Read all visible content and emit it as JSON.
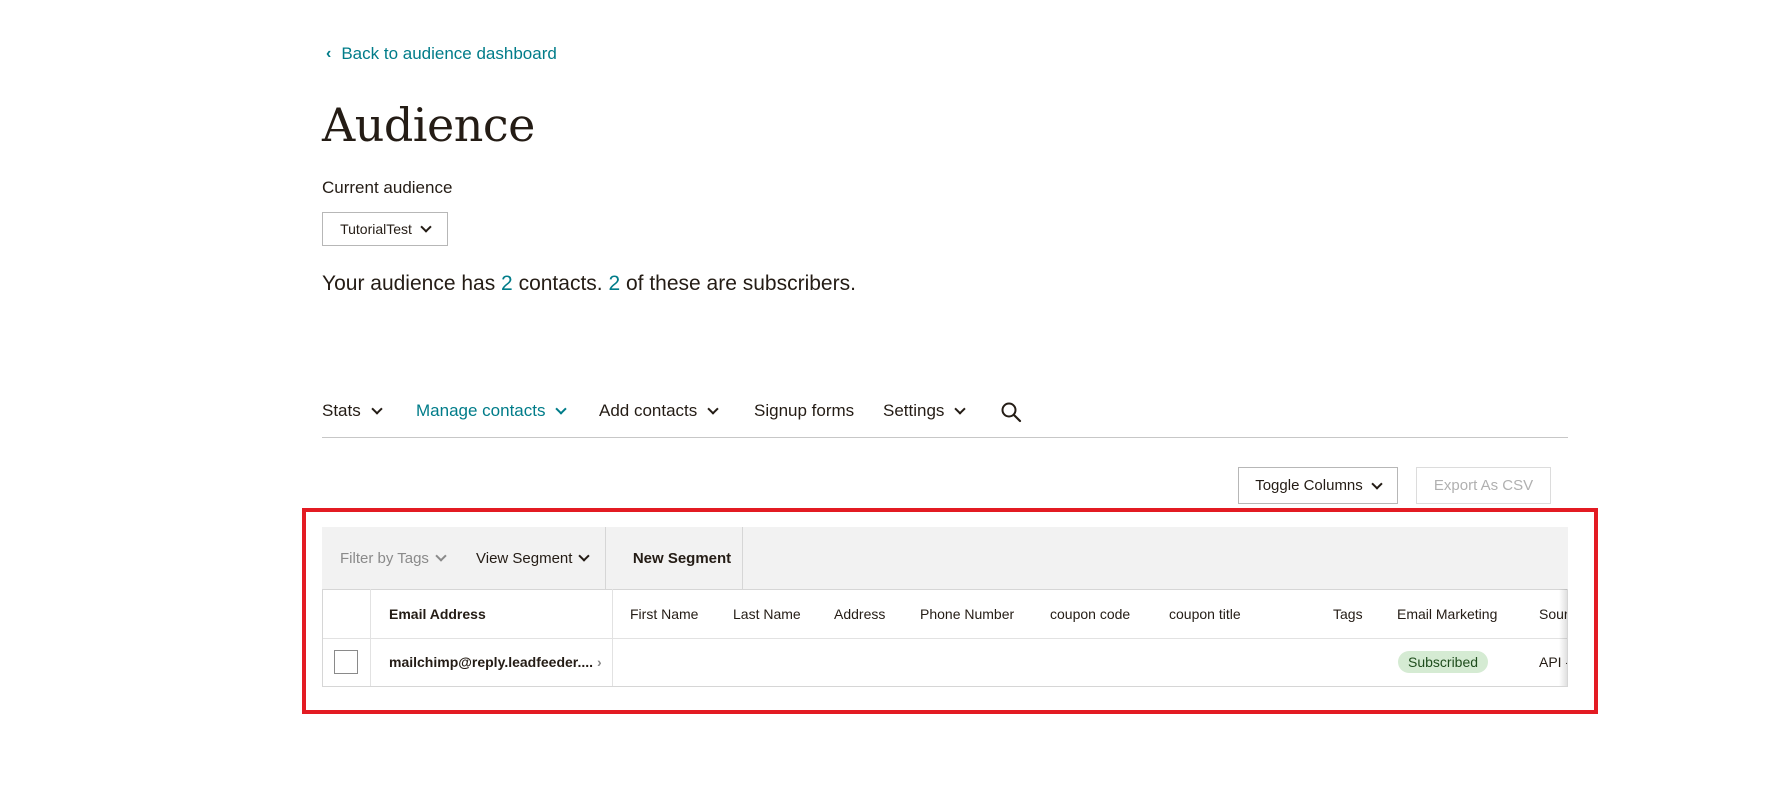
{
  "back_link": {
    "label": "Back to audience dashboard",
    "icon": "chevron-left-icon"
  },
  "page_title": "Audience",
  "current_audience": {
    "label": "Current audience",
    "selected": "TutorialTest"
  },
  "summary": {
    "prefix": "Your audience has ",
    "contacts_count": "2",
    "middle": " contacts. ",
    "subscribers_count": "2",
    "suffix": " of these are subscribers."
  },
  "nav": {
    "items": [
      {
        "label": "Stats",
        "has_dropdown": true
      },
      {
        "label": "Manage contacts",
        "has_dropdown": true,
        "active": true
      },
      {
        "label": "Add contacts",
        "has_dropdown": true
      },
      {
        "label": "Signup forms",
        "has_dropdown": false
      },
      {
        "label": "Settings",
        "has_dropdown": true
      }
    ],
    "search_icon": "search-icon"
  },
  "actions": {
    "toggle_columns": "Toggle Columns",
    "export_csv": "Export As CSV"
  },
  "toolbar": {
    "filter_by_tags": "Filter by Tags",
    "view_segment": "View Segment",
    "new_segment": "New Segment"
  },
  "table": {
    "columns": [
      "Email Address",
      "First Name",
      "Last Name",
      "Address",
      "Phone Number",
      "coupon code",
      "coupon title",
      "Tags",
      "Email Marketing",
      "Sour"
    ],
    "rows": [
      {
        "email": "mailchimp@reply.leadfeeder....",
        "first_name": "",
        "last_name": "",
        "address": "",
        "phone": "",
        "coupon_code": "",
        "coupon_title": "",
        "tags": "",
        "email_marketing": "Subscribed",
        "source": "API -"
      }
    ]
  },
  "colors": {
    "accent": "#007c89",
    "highlight": "#e31b23",
    "badge_bg": "#d5ebd3"
  }
}
